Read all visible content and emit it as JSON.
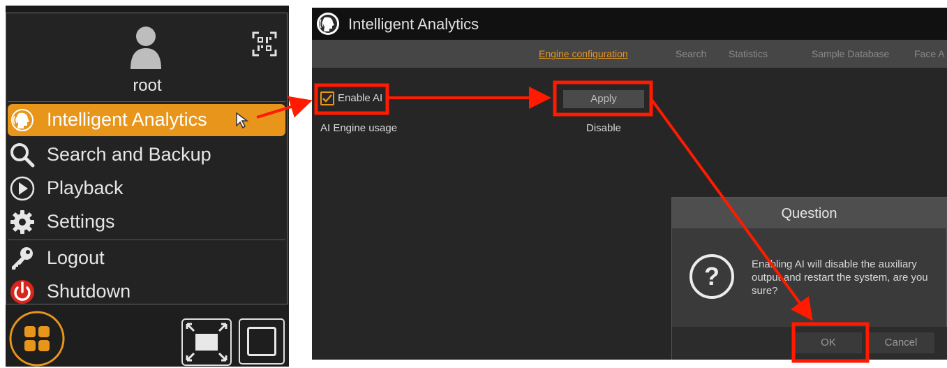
{
  "menu": {
    "user_name": "root",
    "items": [
      {
        "label": "Intelligent Analytics",
        "icon": "ai-head-icon",
        "active": true
      },
      {
        "label": "Search and Backup",
        "icon": "search-icon"
      },
      {
        "label": "Playback",
        "icon": "play-icon"
      },
      {
        "label": "Settings",
        "icon": "gear-icon"
      },
      {
        "label": "Logout",
        "icon": "key-icon"
      },
      {
        "label": "Shutdown",
        "icon": "power-icon"
      }
    ]
  },
  "window": {
    "title": "Intelligent Analytics",
    "tabs": [
      {
        "label": "Engine configuration",
        "active": true
      },
      {
        "label": "Search"
      },
      {
        "label": "Statistics"
      },
      {
        "label": "Sample Database"
      },
      {
        "label": "Face A"
      }
    ],
    "enable_ai": {
      "label": "Enable AI",
      "checked": true
    },
    "engine_usage_label": "AI Engine usage",
    "apply_label": "Apply",
    "engine_usage_value": "Disable"
  },
  "dialog": {
    "title": "Question",
    "message": "Enabling AI will disable the auxiliary output and restart the system, are you sure?",
    "ok_label": "OK",
    "cancel_label": "Cancel"
  },
  "colors": {
    "accent": "#e8951c",
    "annotation": "#ff1a00",
    "panel_bg": "#232323"
  }
}
